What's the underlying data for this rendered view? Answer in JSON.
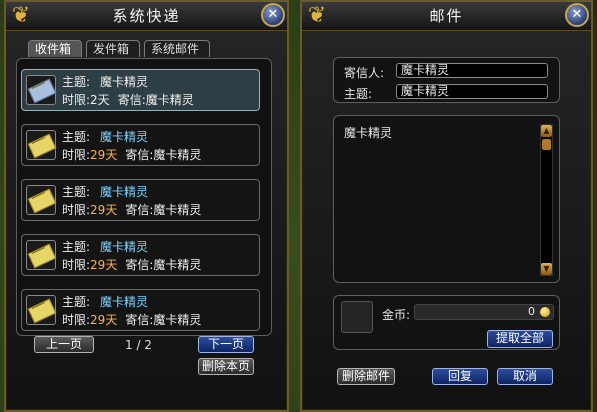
{
  "left": {
    "title": "系统快递",
    "tabs": [
      "收件箱",
      "发件箱",
      "系统邮件"
    ],
    "items": [
      {
        "subject_label": "主题:",
        "subject": "魔卡精灵",
        "time_label": "时限:",
        "time": "2天",
        "sender_label": "寄信:",
        "sender": "魔卡精灵",
        "selected": true
      },
      {
        "subject_label": "主题:",
        "subject": "魔卡精灵",
        "time_label": "时限:",
        "time": "29天",
        "sender_label": "寄信:",
        "sender": "魔卡精灵",
        "selected": false
      },
      {
        "subject_label": "主题:",
        "subject": "魔卡精灵",
        "time_label": "时限:",
        "time": "29天",
        "sender_label": "寄信:",
        "sender": "魔卡精灵",
        "selected": false
      },
      {
        "subject_label": "主题:",
        "subject": "魔卡精灵",
        "time_label": "时限:",
        "time": "29天",
        "sender_label": "寄信:",
        "sender": "魔卡精灵",
        "selected": false
      },
      {
        "subject_label": "主题:",
        "subject": "魔卡精灵",
        "time_label": "时限:",
        "time": "29天",
        "sender_label": "寄信:",
        "sender": "魔卡精灵",
        "selected": false
      }
    ],
    "prev_page": "上一页",
    "next_page": "下一页",
    "page_indicator": "1 / 2",
    "delete_page": "删除本页"
  },
  "right": {
    "title": "邮件",
    "sender_label": "寄信人:",
    "sender_value": "魔卡精灵",
    "subject_label": "主题:",
    "subject_value": "魔卡精灵",
    "body": "魔卡精灵",
    "gold_label": "金币:",
    "gold_value": "0",
    "take_all": "提取全部",
    "delete_mail": "删除邮件",
    "reply": "回复",
    "cancel": "取消"
  },
  "colors": {
    "subject_unread": "#7fd3ff",
    "time_remaining": "#ffb24f",
    "frame_gold": "#6b5a26",
    "button_blue": "#2c4c9c"
  }
}
